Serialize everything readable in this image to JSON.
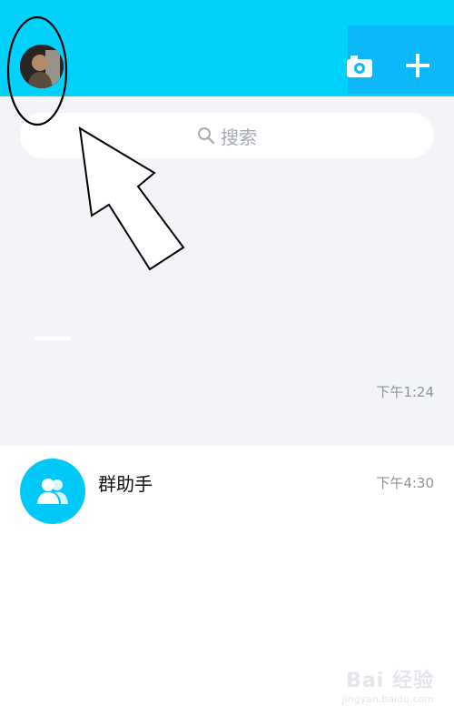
{
  "colors": {
    "header_accent": "#00d2fc",
    "header_right": "#0cb8f8",
    "background": "#f3f4f8",
    "group_avatar": "#00c8f8"
  },
  "header": {
    "avatar_icon": "user-avatar",
    "camera_icon": "camera-icon",
    "add_icon": "plus-icon"
  },
  "search": {
    "placeholder": "搜索",
    "icon": "search-icon"
  },
  "conversation_1": {
    "time": "下午1:24"
  },
  "conversation_2": {
    "title": "群助手",
    "time": "下午4:30",
    "icon": "group-icon"
  },
  "watermark": {
    "main": "Bai 经验",
    "sub": "jingyan.baidu.com"
  }
}
